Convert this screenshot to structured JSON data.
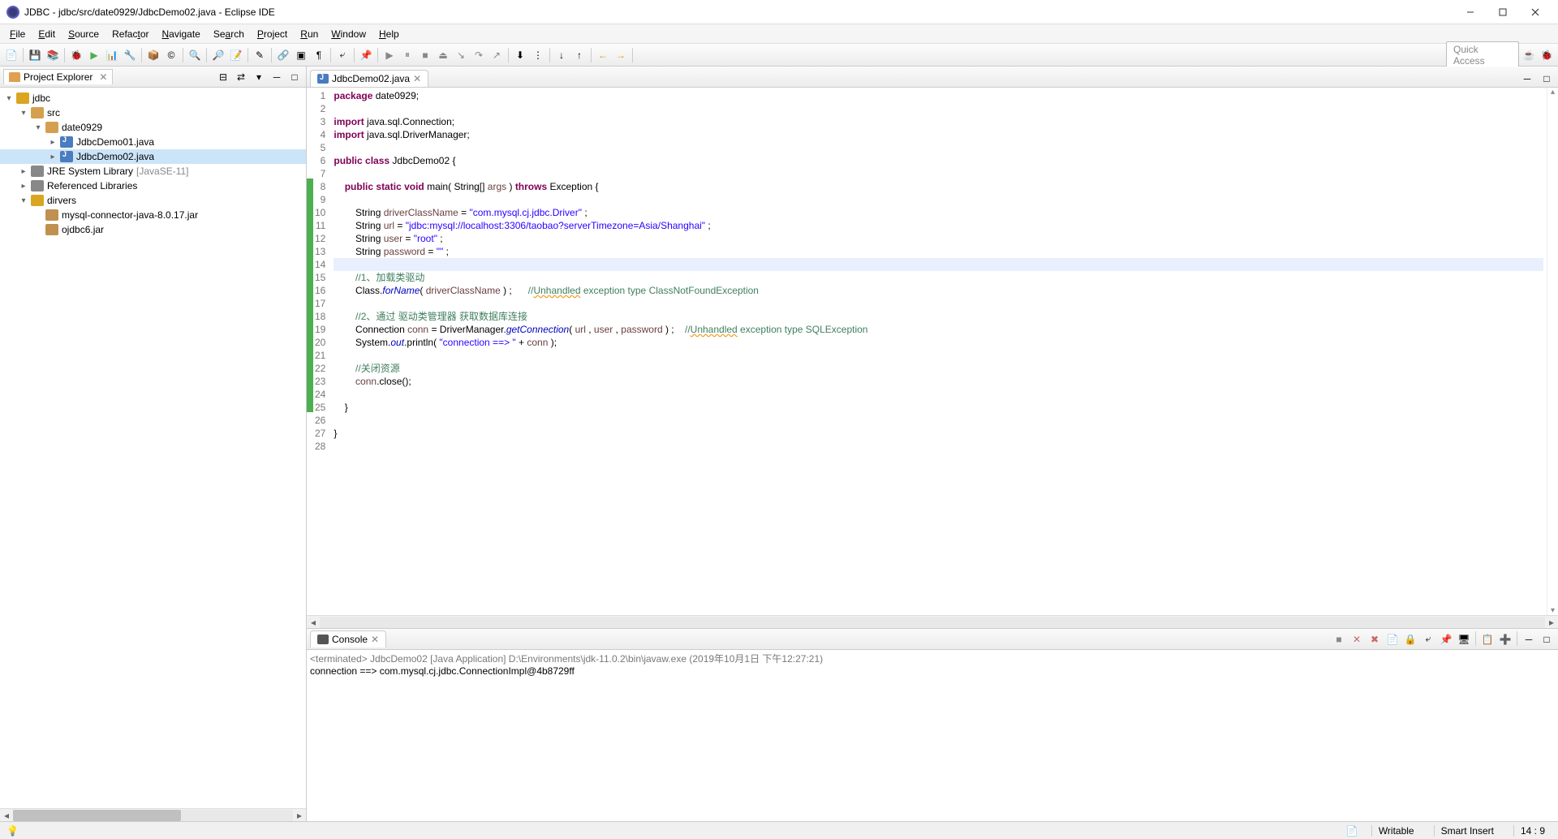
{
  "window": {
    "title": "JDBC - jdbc/src/date0929/JdbcDemo02.java - Eclipse IDE"
  },
  "menu": {
    "items": [
      "File",
      "Edit",
      "Source",
      "Refactor",
      "Navigate",
      "Search",
      "Project",
      "Run",
      "Window",
      "Help"
    ]
  },
  "toolbar": {
    "quick_access": "Quick Access"
  },
  "project_explorer": {
    "title": "Project Explorer",
    "tree": {
      "project": "jdbc",
      "src": "src",
      "package": "date0929",
      "file1": "JdbcDemo01.java",
      "file2": "JdbcDemo02.java",
      "jre": "JRE System Library",
      "jre_extra": "[JavaSE-11]",
      "ref_lib": "Referenced Libraries",
      "drivers": "dirvers",
      "driver1": "mysql-connector-java-8.0.17.jar",
      "driver2": "ojdbc6.jar"
    }
  },
  "editor": {
    "tab_name": "JdbcDemo02.java",
    "lines": [
      {
        "n": "1",
        "html": "<span class='kw'>package</span> date0929;"
      },
      {
        "n": "2",
        "html": ""
      },
      {
        "n": "3",
        "html": "<span class='kw'>import</span> java.sql.Connection;"
      },
      {
        "n": "4",
        "html": "<span class='kw'>import</span> java.sql.DriverManager;"
      },
      {
        "n": "5",
        "html": ""
      },
      {
        "n": "6",
        "html": "<span class='kw'>public</span> <span class='kw'>class</span> JdbcDemo02 {"
      },
      {
        "n": "7",
        "html": ""
      },
      {
        "n": "8",
        "html": "    <span class='kw'>public</span> <span class='kw'>static</span> <span class='kw'>void</span> main( String[] <span class='var'>args</span> ) <span class='kw'>throws</span> Exception {"
      },
      {
        "n": "9",
        "html": ""
      },
      {
        "n": "10",
        "html": "        String <span class='var'>driverClassName</span> = <span class='str'>\"com.mysql.cj.jdbc.Driver\"</span> ;"
      },
      {
        "n": "11",
        "html": "        String <span class='var'>url</span> = <span class='str'>\"jdbc:mysql://localhost:3306/taobao?serverTimezone=Asia/Shanghai\"</span> ;"
      },
      {
        "n": "12",
        "html": "        String <span class='var'>user</span> = <span class='str'>\"root\"</span> ;"
      },
      {
        "n": "13",
        "html": "        String <span class='var'>password</span> = <span class='str'>\"\"</span> ;"
      },
      {
        "n": "14",
        "html": "        "
      },
      {
        "n": "15",
        "html": "        <span class='com'>//1、加载类驱动</span>"
      },
      {
        "n": "16",
        "html": "        Class.<span class='field'>forName</span>( <span class='var'>driverClassName</span> ) ;      <span class='com'>//<span class='warn'>Unhandled</span> exception type ClassNotFoundException</span>"
      },
      {
        "n": "17",
        "html": ""
      },
      {
        "n": "18",
        "html": "        <span class='com'>//2、通过 驱动类管理器 获取数据库连接</span>"
      },
      {
        "n": "19",
        "html": "        Connection <span class='var'>conn</span> = DriverManager.<span class='field'>getConnection</span>( <span class='var'>url</span> , <span class='var'>user</span> , <span class='var'>password</span> ) ;    <span class='com'>//<span class='warn'>Unhandled</span> exception type SQLException</span>"
      },
      {
        "n": "20",
        "html": "        System.<span class='field'>out</span>.println( <span class='str'>\"connection ==> \"</span> + <span class='var'>conn</span> );"
      },
      {
        "n": "21",
        "html": ""
      },
      {
        "n": "22",
        "html": "        <span class='com'>//关闭资源</span>"
      },
      {
        "n": "23",
        "html": "        <span class='var'>conn</span>.close();"
      },
      {
        "n": "24",
        "html": ""
      },
      {
        "n": "25",
        "html": "    }"
      },
      {
        "n": "26",
        "html": ""
      },
      {
        "n": "27",
        "html": "}"
      },
      {
        "n": "28",
        "html": ""
      }
    ]
  },
  "console": {
    "title": "Console",
    "status": "<terminated> JdbcDemo02 [Java Application] D:\\Environments\\jdk-11.0.2\\bin\\javaw.exe (2019年10月1日 下午12:27:21)",
    "output": "connection ==> com.mysql.cj.jdbc.ConnectionImpl@4b8729ff"
  },
  "statusbar": {
    "writable": "Writable",
    "insert": "Smart Insert",
    "cursor": "14 : 9"
  }
}
